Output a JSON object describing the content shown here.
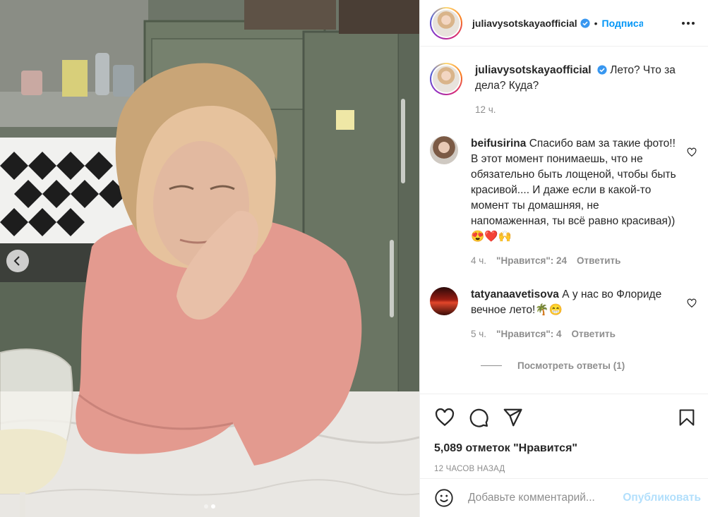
{
  "post": {
    "username": "juliavysotskaya​official",
    "follow_label": "Подписаться",
    "bullet": "•",
    "caption_text": "Лето? Что за дела? Куда?",
    "caption_time": "12 ч.",
    "comments": [
      {
        "username": "beifusirina",
        "text": "Спасибо вам за такие фото!! В этот момент понимаешь, что не обязательно быть лощеной, чтобы быть красивой.... И даже если в какой-то момент ты домашняя, не напомаженная, ты всё равно красивая))😍❤️🙌",
        "time": "4 ч.",
        "likes": "\"Нравится\": 24",
        "reply": "Ответить"
      },
      {
        "username": "tatyanaavetisova",
        "text": "А у нас во Флориде вечное лето!🌴😁",
        "time": "5 ч.",
        "likes": "\"Нравится\": 4",
        "reply": "Ответить"
      }
    ],
    "view_replies": "Посмотреть ответы (1)",
    "likes_count": "5,089 отметок \"Нравится\"",
    "date": "12 ЧАСОВ НАЗАД",
    "comment_placeholder": "Добавьте комментарий...",
    "publish_label": "Опубликовать"
  },
  "carousel": {
    "slide_count": 2,
    "active_index": 1
  },
  "icons": {
    "verified": "verified-badge-icon",
    "more": "more-horizontal-icon",
    "like": "heart-icon",
    "comment": "comment-bubble-icon",
    "share": "paper-plane-icon",
    "save": "bookmark-icon",
    "emoji": "smiley-icon",
    "prev": "chevron-left-icon"
  },
  "colors": {
    "accent": "#0095f6",
    "muted": "#8e8e8e",
    "text": "#262626",
    "publish_disabled": "#b2dffc"
  }
}
